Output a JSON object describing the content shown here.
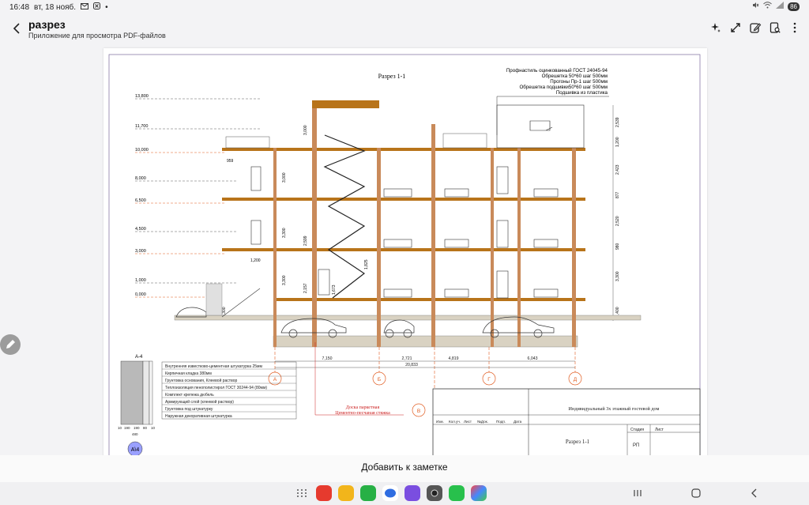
{
  "status": {
    "time": "16:48",
    "date": "вт, 18 нояб.",
    "battery": "86"
  },
  "header": {
    "title": "разрез",
    "subtitle": "Приложение для просмотра PDF-файлов"
  },
  "drawing": {
    "title": "Разрез 1-1",
    "roof_notes": [
      "Профнастиль оцинкованный ГОСТ 24045-94",
      "Обрешетка 50*60 шаг 500мм",
      "Прогоны Пр-1 шаг 500мм",
      "Обрешетка подшивки50*60 шаг 500мм",
      "Подшивка из пластика"
    ],
    "elevations": [
      "13,800",
      "11,700",
      "10,000",
      "8,000",
      "6,500",
      "4,500",
      "3,000",
      "1,000",
      "0,000"
    ],
    "dims_left": [
      "3,000",
      "3,300",
      "3,300",
      "3,300"
    ],
    "dims_inner": [
      "3,000",
      "2,599",
      "2,157",
      "1,673",
      "1,825"
    ],
    "dims_right": [
      "2,539",
      "1,200",
      "2,423",
      "877",
      "2,520",
      "980",
      "3,300",
      "1,400"
    ],
    "dim_959": "959",
    "dim_1200": "1,200",
    "bottom_dims": [
      "7,150",
      "2,721",
      "4,819",
      "6,043"
    ],
    "total_dim": "20,833",
    "axes": [
      "А",
      "Б",
      "В",
      "Г",
      "Д"
    ],
    "wall_section_label": "А-4",
    "wall_layers": [
      "Внутренняя известково-цементная штукатурка 25мм",
      "Кирпичная кладка 380мм",
      "Грунтовка основания, Клеевой раствор",
      "Теплоизоляция пенополистирол ГОСТ 30244-94 (80мм)",
      "Комплект крепежа дюбель",
      "Армирующий слой (клеевой раствор)",
      "Грунтовка под штукатурку",
      "Наружная декоративная штукатурка"
    ],
    "wall_dims": [
      "10",
      "190",
      "190",
      "80",
      "10"
    ],
    "wall_total": "480",
    "wall_tag": "А\\4",
    "floor_notes": [
      "Доска паркетная",
      "Цементно-песчаная стяжка"
    ],
    "stamp": {
      "headers": [
        "Изм.",
        "Кол.уч.",
        "Лист",
        "№Док.",
        "Подп.",
        "Дата"
      ],
      "project": "Индивидуальный 3х этажный гостевой дом",
      "sheet_title": "Разрез 1-1",
      "stage_label": "Стадия",
      "sheet_label": "Лист",
      "stage_value": "РП"
    }
  },
  "footer": {
    "add_note": "Добавить к заметке"
  },
  "colors": {
    "slab": "#b8741a",
    "axis": "#e05a1e",
    "dim_text": "#222222",
    "red_note": "#cc2222"
  }
}
